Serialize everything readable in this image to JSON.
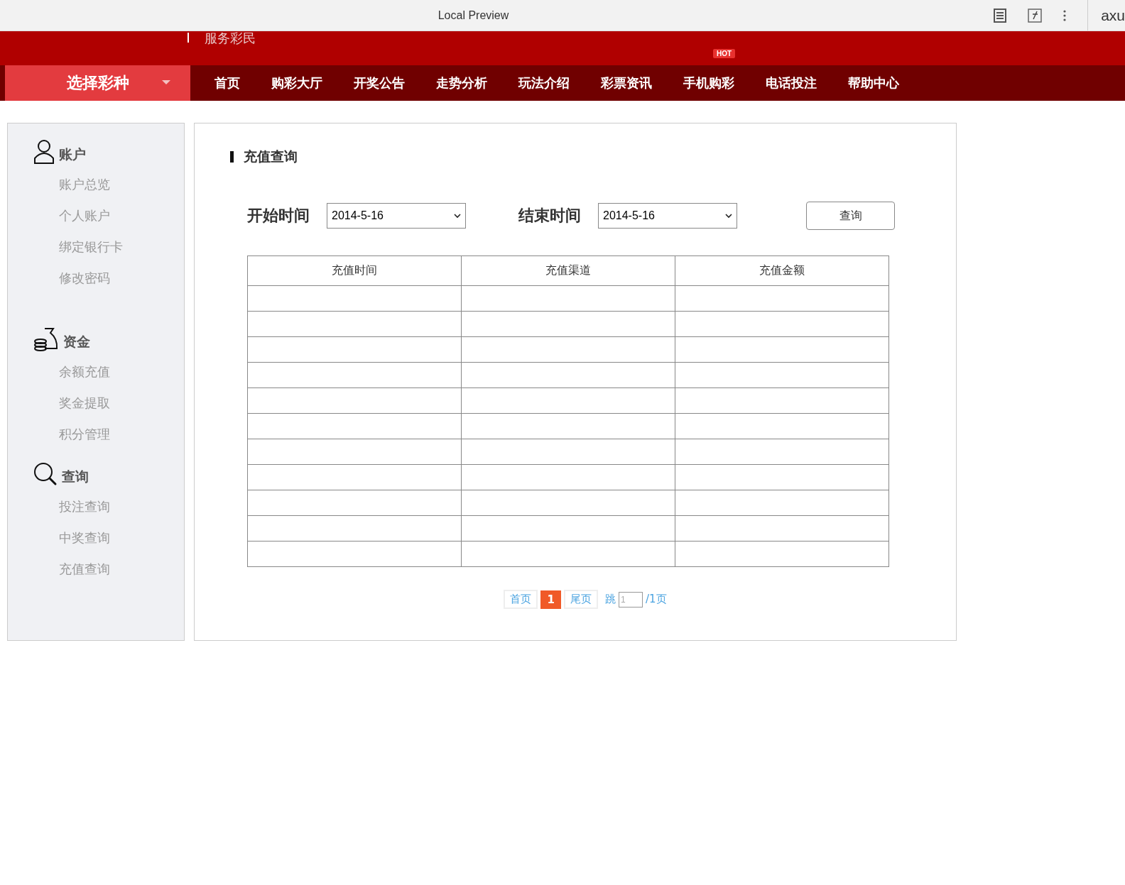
{
  "browser": {
    "title": "Local Preview",
    "extension_label": "axu"
  },
  "header": {
    "slogan": "服务彩民"
  },
  "nav": {
    "lottery_picker": "选择彩种",
    "items": [
      {
        "label": "首页"
      },
      {
        "label": "购彩大厅"
      },
      {
        "label": "开奖公告"
      },
      {
        "label": "走势分析"
      },
      {
        "label": "玩法介绍"
      },
      {
        "label": "彩票资讯"
      },
      {
        "label": "手机购彩",
        "badge": "HOT"
      },
      {
        "label": "电话投注"
      },
      {
        "label": "帮助中心"
      }
    ]
  },
  "sidebar": {
    "sections": [
      {
        "kind": "user",
        "title": "账户",
        "items": [
          "账户总览",
          "个人账户",
          "绑定银行卡",
          "修改密码"
        ]
      },
      {
        "kind": "money",
        "title": "资金",
        "items": [
          "余额充值",
          "奖金提取",
          "积分管理"
        ]
      },
      {
        "kind": "search",
        "title": "查询",
        "items": [
          "投注查询",
          "中奖查询",
          "充值查询"
        ]
      }
    ]
  },
  "main": {
    "title": "充值查询",
    "start_label": "开始时间",
    "start_value": "2014-5-16",
    "end_label": "结束时间",
    "end_value": "2014-5-16",
    "query_button": "查询",
    "table": {
      "columns": [
        "充值时间",
        "充值渠道",
        "充值金额"
      ]
    },
    "pagination": {
      "first": "首页",
      "pages": [
        {
          "label": "1",
          "selected": true
        }
      ],
      "last": "尾页",
      "jump_label": "跳",
      "jump_value": "1",
      "total": "/1页"
    }
  }
}
